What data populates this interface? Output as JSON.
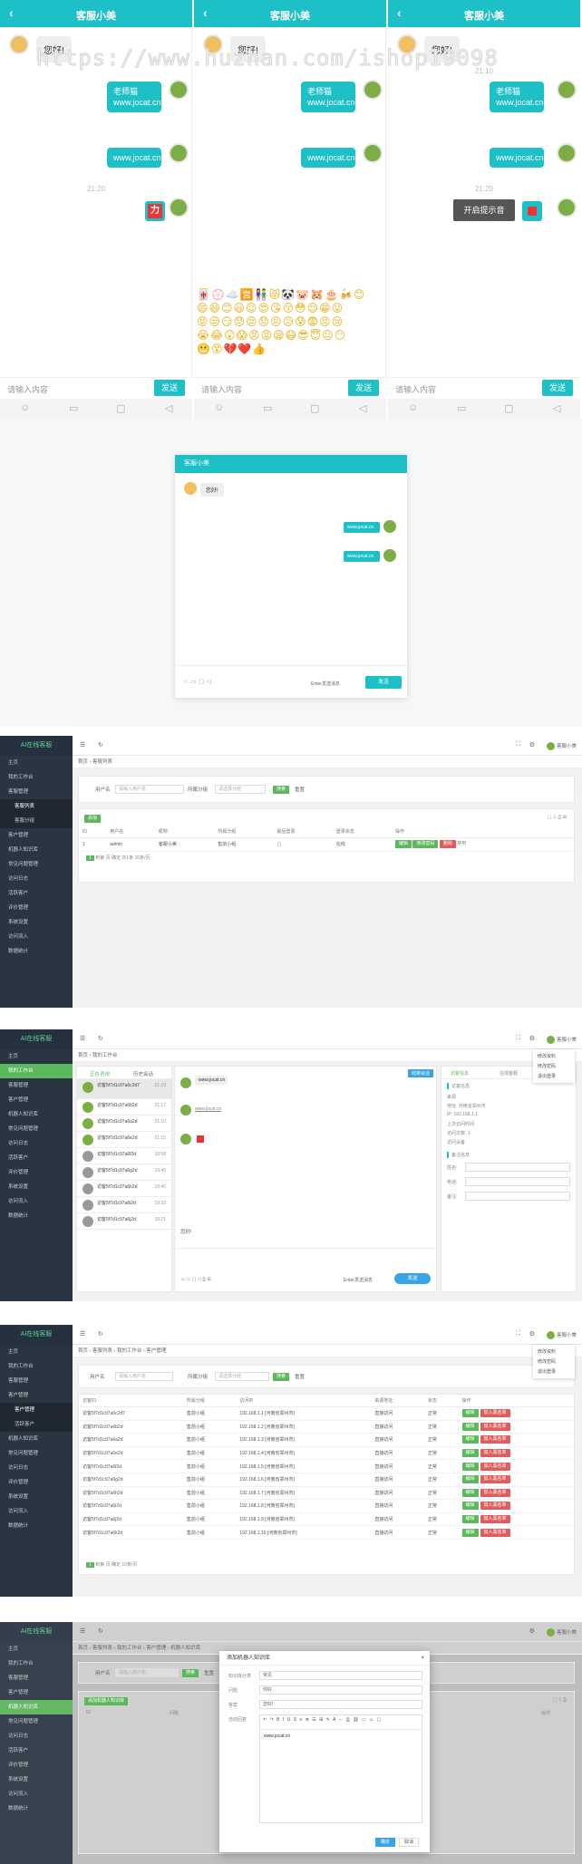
{
  "mobile": {
    "title": "客服小美",
    "back_icon": "‹",
    "greeting": "您好!",
    "link_text": "www.jocat.cn",
    "link_label": "老师猫",
    "time1": "21:10",
    "time2": "21:20",
    "emoji_badge": "力",
    "prompt_button": "开启提示音",
    "input_placeholder": "请输入内容",
    "send": "发送",
    "tools": [
      "☺",
      "▭",
      "▢",
      "◁"
    ],
    "emoji_rows": [
      "🀄💮☁️🈺👫😾🐼🐷🐹🎂🍻😊",
      "😄😆😊😃😉😍😘😚😳😌😁😜",
      "😝😒😏😓😔😞😖😥😰😨😣😢",
      "😭😂😲😱😠😡😪😷😎😇😐😶",
      "😬😵💔❤️👍"
    ],
    "watermark": "https://www.huzhan.com/ishop19098"
  },
  "pc_chat": {
    "header": "客服小美",
    "greeting": "您好!",
    "link_text": "www.jocat.cn",
    "send": "发送",
    "enter_tip": "Enter发送消息"
  },
  "admin": {
    "logo": "AI在线客服",
    "menu": [
      "主页",
      "我的工作台",
      "客服管理",
      "客服列表",
      "客服分组",
      "客户管理",
      "机器人知识库",
      "常见问题管理",
      "访问日志",
      "活跃客户",
      "评价管理",
      "系统设置",
      "访问流入",
      "数据统计"
    ],
    "crumb_home": "首页",
    "crumb_list": "客服列表",
    "crumb_work": "我的工作台",
    "crumb_customer": "客户管理",
    "crumb_robot": "机器人知识库",
    "user": "客服小美",
    "search_label": "用户名",
    "search_placeholder": "请输入用户名",
    "group_label": "所属分组",
    "group_placeholder": "请选择分组",
    "search_btn": "搜索",
    "reset_btn": "重置",
    "add_btn": "添加",
    "add_robot_btn": "添加机器人知识库",
    "list_cols": [
      "ID",
      "用户名",
      "昵称",
      "所属分组",
      "最后登录",
      "登录状态",
      "操作"
    ],
    "list_row": [
      "1",
      "admin",
      "客服小美",
      "售前小组",
      "",
      "",
      "在线"
    ],
    "ops": [
      "编辑",
      "修改密码",
      "删除",
      "禁用"
    ],
    "paging": [
      "1",
      "到第",
      "页",
      "确定",
      "共1条",
      "10条/页"
    ],
    "dropdown": [
      "修改资料",
      "修改密码",
      "退出登录"
    ],
    "work_tabs": [
      "正在咨询",
      "历史会话"
    ],
    "work_info_tabs": [
      "访客信息",
      "在线客服"
    ],
    "sessions": [
      {
        "name": "访客5f7d1c97a6c2d7",
        "time": "21:19"
      },
      {
        "name": "访客5f7d1c97a6b2d",
        "time": "21:17"
      },
      {
        "name": "访客5f7d1c97a6a2d",
        "time": "21:16"
      },
      {
        "name": "访客5f7d1c97a6e2d",
        "time": "21:15"
      },
      {
        "name": "访客5f7d1c97a6f2d",
        "time": "19:58"
      },
      {
        "name": "访客5f7d1c97a6g2d",
        "time": "19:45"
      },
      {
        "name": "访客5f7d1c97a6h2d",
        "time": "19:40"
      },
      {
        "name": "访客5f7d1c97a6i2d",
        "time": "19:32"
      },
      {
        "name": "访客5f7d1c97a6j2d",
        "time": "19:21"
      }
    ],
    "visitor_info": [
      "访客信息",
      "来源",
      "地址: 河南省郑州市",
      "IP: 192.168.1.1",
      "上次访问时间",
      "访问次数: 1",
      "访问设备",
      "备注信息",
      "姓名:",
      "电话:",
      "备注:"
    ],
    "save_btn": "保存",
    "end_btn": "结束会话",
    "customer_cols": [
      "访客ID",
      "所属分组",
      "访问IP",
      "来源地址",
      "访问时间",
      "状态",
      "操作"
    ],
    "customer_rows": [
      [
        "访客5f7d1c97a6c2d7",
        "售前小组",
        "192.168.1.1 [河南省郑州市]",
        "直接访问",
        "2020-10-07 21:19",
        "正常"
      ],
      [
        "访客5f7d1c97a6b2d",
        "售前小组",
        "192.168.1.2 [河南省郑州市]",
        "直接访问",
        "2020-10-07 21:17",
        "正常"
      ],
      [
        "访客5f7d1c97a6a2d",
        "售前小组",
        "192.168.1.3 [河南省郑州市]",
        "直接访问",
        "2020-10-07 21:16",
        "正常"
      ],
      [
        "访客5f7d1c97a6e2d",
        "售前小组",
        "192.168.1.4 [河南省郑州市]",
        "直接访问",
        "2020-10-07 21:15",
        "正常"
      ],
      [
        "访客5f7d1c97a6f2d",
        "售前小组",
        "192.168.1.5 [河南省郑州市]",
        "直接访问",
        "2020-10-07 19:58",
        "正常"
      ],
      [
        "访客5f7d1c97a6g2d",
        "售前小组",
        "192.168.1.6 [河南省郑州市]",
        "直接访问",
        "2020-10-07 19:45",
        "正常"
      ],
      [
        "访客5f7d1c97a6h2d",
        "售前小组",
        "192.168.1.7 [河南省郑州市]",
        "直接访问",
        "2020-10-07 19:40",
        "正常"
      ],
      [
        "访客5f7d1c97a6i2d",
        "售前小组",
        "192.168.1.8 [河南省郑州市]",
        "直接访问",
        "2020-10-07 19:32",
        "正常"
      ],
      [
        "访客5f7d1c97a6j2d",
        "售前小组",
        "192.168.1.9 [河南省郑州市]",
        "直接访问",
        "2020-10-07 19:21",
        "正常"
      ],
      [
        "访客5f7d1c97a6k2d",
        "售前小组",
        "192.168.1.10 [河南省郑州市]",
        "直接访问",
        "2020-10-07 19:10",
        "正常"
      ]
    ],
    "customer_ops": [
      "编辑",
      "加入黑名单"
    ],
    "robot_cols": [
      "ID",
      "问题",
      "答案",
      "状态",
      "操作"
    ],
    "modal_title": "添加机器人知识库",
    "modal_fields": [
      "知识库分类",
      "问题",
      "答案",
      "自动回复"
    ],
    "modal_values": [
      "常见",
      "你好",
      "您好!",
      "www.jocat.cn"
    ],
    "modal_confirm": "确定",
    "modal_cancel": "取消"
  },
  "colors": {
    "teal": "#1cc0c6",
    "green": "#5cb85c",
    "red": "#e05d5d",
    "sidebar": "#2a3542"
  }
}
